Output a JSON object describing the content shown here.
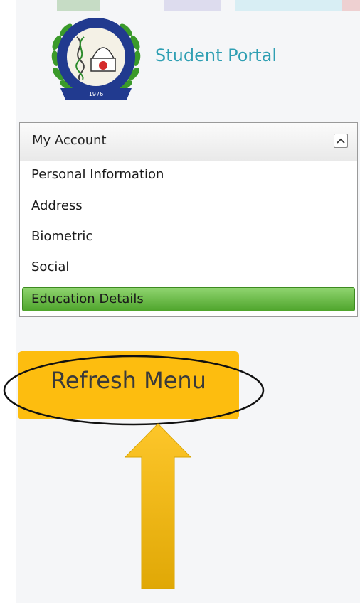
{
  "header": {
    "logo_text": "1976",
    "portal_title": "Student Portal"
  },
  "menu": {
    "header_label": "My Account",
    "collapse_icon": "chevron-up-icon",
    "items": [
      {
        "label": "Personal Information",
        "active": false
      },
      {
        "label": "Address",
        "active": false
      },
      {
        "label": "Biometric",
        "active": false
      },
      {
        "label": "Social",
        "active": false
      },
      {
        "label": "Education Details",
        "active": true
      }
    ]
  },
  "refresh": {
    "label": "Refresh Menu"
  },
  "annotations": {
    "highlight": "ellipse-outline",
    "pointer": "up-arrow"
  },
  "colors": {
    "title_teal": "#2f9fb3",
    "active_green": "#5cb536",
    "button_yellow": "#fdbd0f",
    "arrow_yellow": "#fcc10e",
    "logo_blue": "#213a8f"
  }
}
